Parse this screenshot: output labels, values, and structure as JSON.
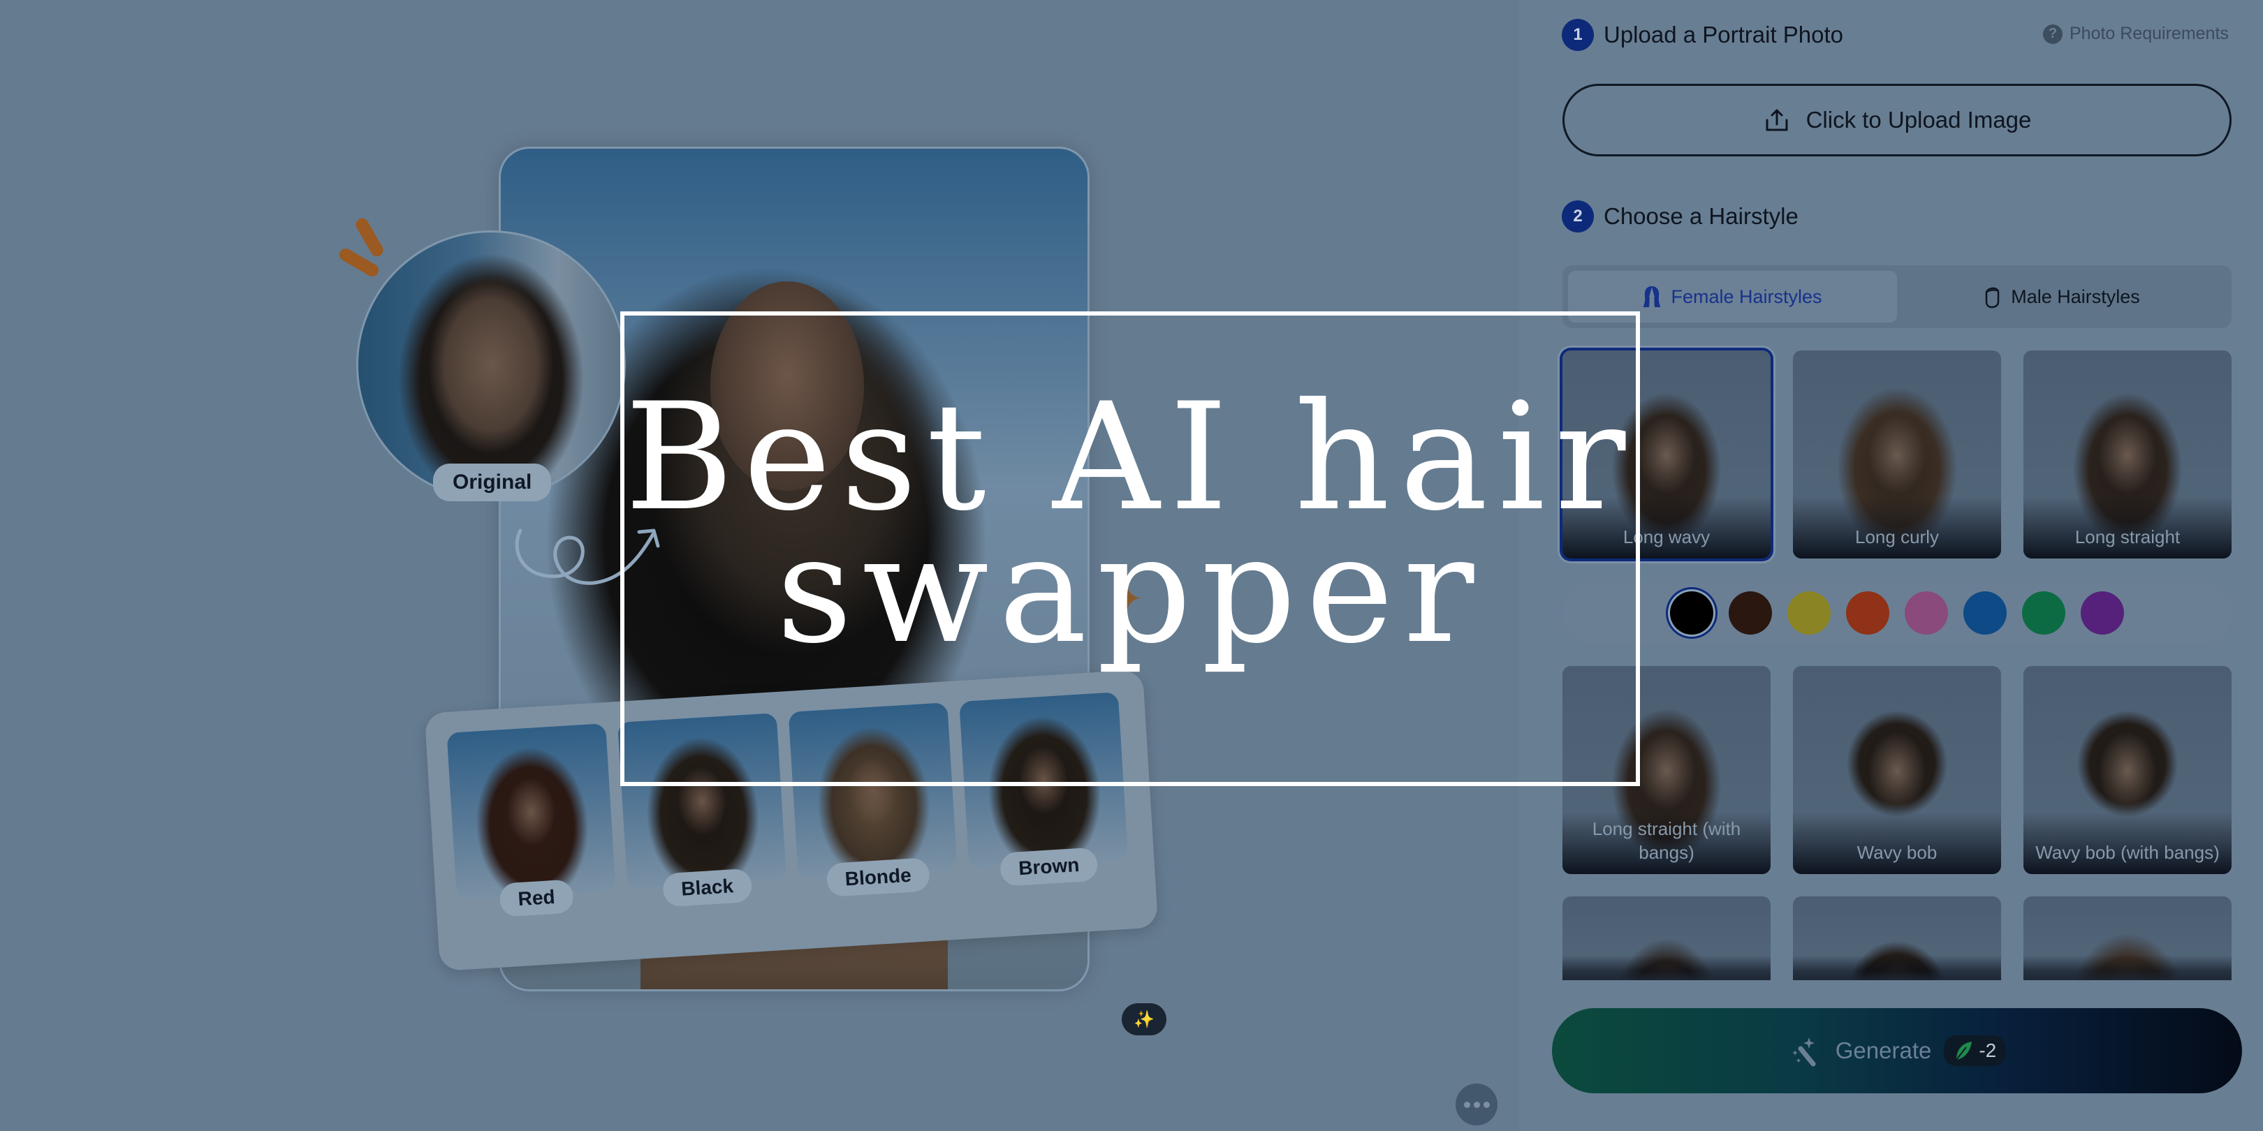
{
  "overlay": {
    "title_line1": "Best AI hair",
    "title_line2": "swapper"
  },
  "preview": {
    "original_label": "Original",
    "color_variants": [
      {
        "label": "Red"
      },
      {
        "label": "Black"
      },
      {
        "label": "Blonde"
      },
      {
        "label": "Brown"
      }
    ],
    "icons": {
      "magic": "magic-wand-icon",
      "more": "more-horizontal-icon"
    }
  },
  "panel": {
    "step1": {
      "number": "1",
      "title": "Upload a Portrait Photo",
      "requirements_link": "Photo Requirements",
      "upload_button": "Click to Upload Image"
    },
    "step2": {
      "number": "2",
      "title": "Choose a Hairstyle",
      "tabs": [
        {
          "label": "Female Hairstyles",
          "active": true
        },
        {
          "label": "Male Hairstyles",
          "active": false
        }
      ]
    },
    "hairstyles_row1": [
      {
        "label": "Long wavy",
        "selected": true
      },
      {
        "label": "Long curly",
        "selected": false
      },
      {
        "label": "Long straight",
        "selected": false
      }
    ],
    "hairstyles_row2": [
      {
        "label": "Long straight (with bangs)"
      },
      {
        "label": "Wavy bob"
      },
      {
        "label": "Wavy bob (with bangs)"
      }
    ],
    "hair_colors": [
      {
        "name": "black",
        "hex": "#000000",
        "selected": true
      },
      {
        "name": "dark-brown",
        "hex": "#2a1710"
      },
      {
        "name": "yellow",
        "hex": "#8a8424"
      },
      {
        "name": "red",
        "hex": "#8f3218"
      },
      {
        "name": "pink",
        "hex": "#8a4a7a"
      },
      {
        "name": "blue",
        "hex": "#0d4a86"
      },
      {
        "name": "green",
        "hex": "#0d6b44"
      },
      {
        "name": "purple",
        "hex": "#55217a"
      }
    ],
    "generate": {
      "label": "Generate",
      "cost": "-2"
    }
  }
}
